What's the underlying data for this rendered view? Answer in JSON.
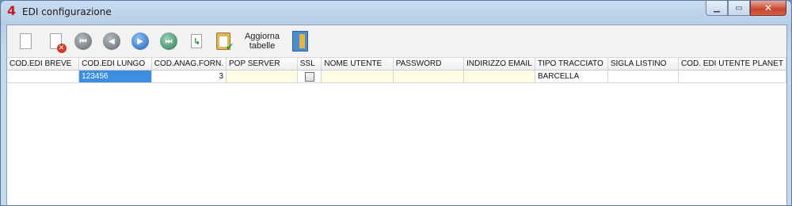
{
  "window": {
    "title": "EDI configurazione",
    "app_icon": "4"
  },
  "toolbar": {
    "aggiorna_label_line1": "Aggiorna",
    "aggiorna_label_line2": "tabelle"
  },
  "table": {
    "headers": [
      "COD.EDI BREVE",
      "COD.EDI LUNGO",
      "COD.ANAG.FORN.",
      "POP SERVER",
      "SSL",
      "NOME UTENTE",
      "PASSWORD",
      "INDIRIZZO EMAIL",
      "TIPO TRACCIATO",
      "SIGLA LISTINO",
      "COD. EDI UTENTE PLANET"
    ],
    "row": {
      "cod_edi_breve": "",
      "cod_edi_lungo": "123456",
      "cod_anag_forn": "3",
      "pop_server": "",
      "ssl_checked": false,
      "nome_utente": "",
      "password": "",
      "indirizzo_email": "",
      "tipo_tracciato": "BARCELLA",
      "sigla_listino": "",
      "cod_edi_utente_planet": ""
    }
  }
}
